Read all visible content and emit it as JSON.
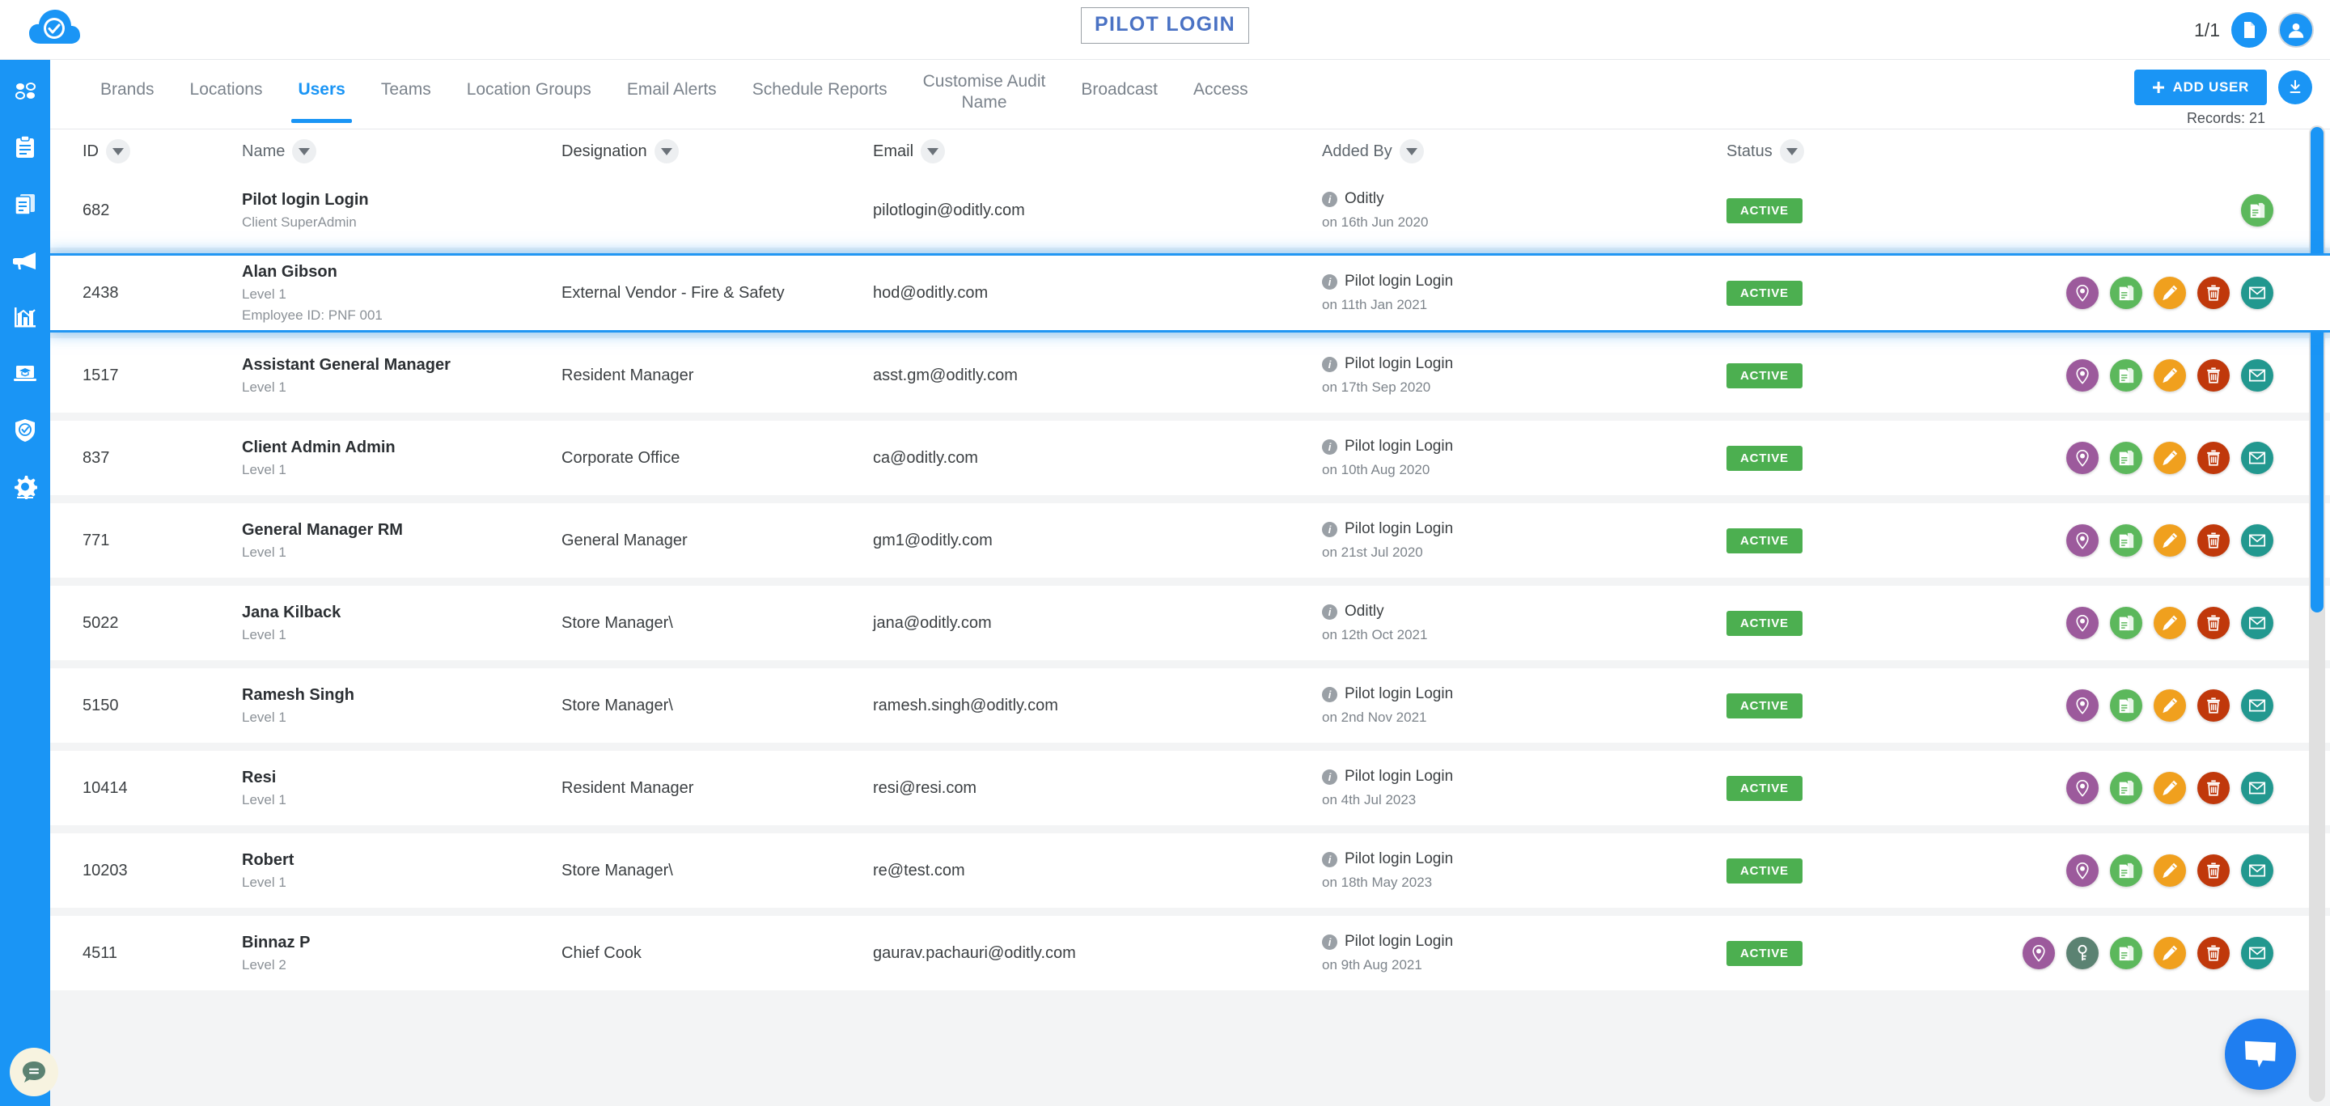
{
  "header": {
    "logo_icon": "cloud-check-icon",
    "title": "PILOT LOGIN",
    "page_count": "1/1",
    "doc_icon": "document-icon",
    "avatar_icon": "user-avatar-icon"
  },
  "sidebar": {
    "items": [
      {
        "icon": "dashboard-dots-icon",
        "name": "dashboard"
      },
      {
        "icon": "clipboard-icon",
        "name": "audits"
      },
      {
        "icon": "documents-icon",
        "name": "reports"
      },
      {
        "icon": "megaphone-icon",
        "name": "broadcast"
      },
      {
        "icon": "bar-chart-icon",
        "name": "analytics"
      },
      {
        "icon": "training-laptop-icon",
        "name": "training"
      },
      {
        "icon": "shield-check-icon",
        "name": "compliance"
      },
      {
        "icon": "gear-icon",
        "name": "settings"
      }
    ]
  },
  "tabs": [
    {
      "label": "Brands",
      "active": false
    },
    {
      "label": "Locations",
      "active": false
    },
    {
      "label": "Users",
      "active": true
    },
    {
      "label": "Teams",
      "active": false
    },
    {
      "label": "Location Groups",
      "active": false
    },
    {
      "label": "Email Alerts",
      "active": false
    },
    {
      "label": "Schedule Reports",
      "active": false
    },
    {
      "label": "Customise Audit\nName",
      "active": false
    },
    {
      "label": "Broadcast",
      "active": false
    },
    {
      "label": "Access",
      "active": false
    }
  ],
  "toolbar": {
    "add_user_label": "ADD USER",
    "add_icon": "plus-icon",
    "download_icon": "download-icon",
    "records_label": "Records: 21"
  },
  "table": {
    "columns": [
      {
        "label": "ID"
      },
      {
        "label": "Name"
      },
      {
        "label": "Designation"
      },
      {
        "label": "Email"
      },
      {
        "label": "Added By"
      },
      {
        "label": "Status"
      }
    ],
    "rows": [
      {
        "id": "682",
        "name": "Pilot login Login",
        "sub1": "Client SuperAdmin",
        "sub2": "",
        "designation": "",
        "email": "pilotlogin@oditly.com",
        "added_by": "Oditly",
        "added_on": "on 16th Jun 2020",
        "status": "ACTIVE",
        "actions": [
          "document"
        ],
        "highlight": false
      },
      {
        "id": "2438",
        "name": "Alan Gibson",
        "sub1": "Level 1",
        "sub2": "Employee ID: PNF 001",
        "designation": "External Vendor - Fire & Safety",
        "email": "hod@oditly.com",
        "added_by": "Pilot login Login",
        "added_on": "on 11th Jan 2021",
        "status": "ACTIVE",
        "actions": [
          "location",
          "document",
          "edit",
          "delete",
          "email"
        ],
        "highlight": true
      },
      {
        "id": "1517",
        "name": "Assistant General Manager",
        "sub1": "Level 1",
        "sub2": "",
        "designation": "Resident Manager",
        "email": "asst.gm@oditly.com",
        "added_by": "Pilot login Login",
        "added_on": "on 17th Sep 2020",
        "status": "ACTIVE",
        "actions": [
          "location",
          "document",
          "edit",
          "delete",
          "email"
        ],
        "highlight": false
      },
      {
        "id": "837",
        "name": "Client Admin Admin",
        "sub1": "Level 1",
        "sub2": "",
        "designation": "Corporate Office",
        "email": "ca@oditly.com",
        "added_by": "Pilot login Login",
        "added_on": "on 10th Aug 2020",
        "status": "ACTIVE",
        "actions": [
          "location",
          "document",
          "edit",
          "delete",
          "email"
        ],
        "highlight": false
      },
      {
        "id": "771",
        "name": "General Manager RM",
        "sub1": "Level 1",
        "sub2": "",
        "designation": "General Manager",
        "email": "gm1@oditly.com",
        "added_by": "Pilot login Login",
        "added_on": "on 21st Jul 2020",
        "status": "ACTIVE",
        "actions": [
          "location",
          "document",
          "edit",
          "delete",
          "email"
        ],
        "highlight": false
      },
      {
        "id": "5022",
        "name": "Jana Kilback",
        "sub1": "Level 1",
        "sub2": "",
        "designation": "Store Manager\\",
        "email": "jana@oditly.com",
        "added_by": "Oditly",
        "added_on": "on 12th Oct 2021",
        "status": "ACTIVE",
        "actions": [
          "location",
          "document",
          "edit",
          "delete",
          "email"
        ],
        "highlight": false
      },
      {
        "id": "5150",
        "name": "Ramesh Singh",
        "sub1": "Level 1",
        "sub2": "",
        "designation": "Store Manager\\",
        "email": "ramesh.singh@oditly.com",
        "added_by": "Pilot login Login",
        "added_on": "on 2nd Nov 2021",
        "status": "ACTIVE",
        "actions": [
          "location",
          "document",
          "edit",
          "delete",
          "email"
        ],
        "highlight": false
      },
      {
        "id": "10414",
        "name": "Resi",
        "sub1": "Level 1",
        "sub2": "",
        "designation": "Resident Manager",
        "email": "resi@resi.com",
        "added_by": "Pilot login Login",
        "added_on": "on 4th Jul 2023",
        "status": "ACTIVE",
        "actions": [
          "location",
          "document",
          "edit",
          "delete",
          "email"
        ],
        "highlight": false
      },
      {
        "id": "10203",
        "name": "Robert",
        "sub1": "Level 1",
        "sub2": "",
        "designation": "Store Manager\\",
        "email": "re@test.com",
        "added_by": "Pilot login Login",
        "added_on": "on 18th May 2023",
        "status": "ACTIVE",
        "actions": [
          "location",
          "document",
          "edit",
          "delete",
          "email"
        ],
        "highlight": false
      },
      {
        "id": "4511",
        "name": "Binnaz P",
        "sub1": "Level 2",
        "sub2": "",
        "designation": "Chief Cook",
        "email": "gaurav.pachauri@oditly.com",
        "added_by": "Pilot login Login",
        "added_on": "on 9th Aug 2021",
        "status": "ACTIVE",
        "actions": [
          "location",
          "key",
          "document",
          "edit",
          "delete",
          "email"
        ],
        "highlight": false
      }
    ]
  },
  "widgets": {
    "chat_left_icon": "chat-bubble-icon",
    "chat_right_icon": "message-bubble-icon"
  },
  "colors": {
    "accent": "#1a95f5",
    "status_active": "#4caf50",
    "action_location": "#9c5a9c",
    "action_key": "#5b8272",
    "action_document": "#5cb85c",
    "action_edit": "#f0a01e",
    "action_delete": "#c0380b",
    "action_email": "#22988f"
  }
}
